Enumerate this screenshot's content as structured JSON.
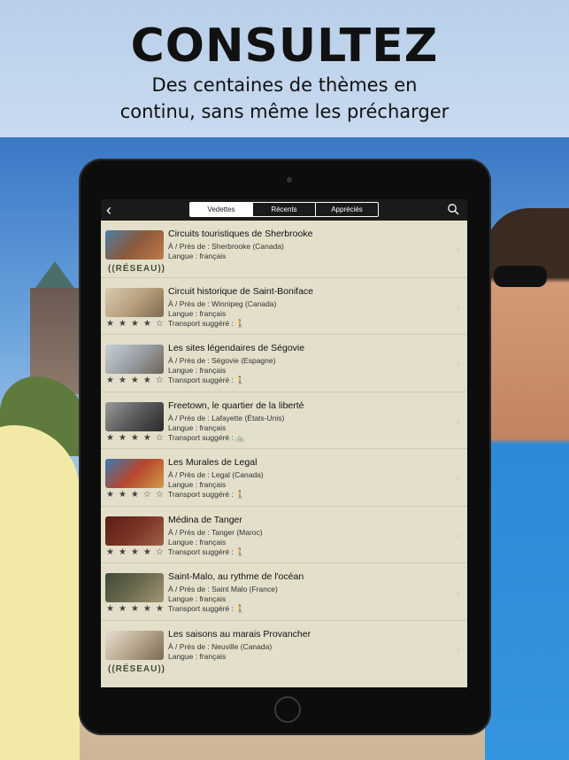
{
  "promo": {
    "headline": "CONSULTEZ",
    "subtitle_line1": "Des centaines de thèmes en",
    "subtitle_line2": "continu, sans même les précharger"
  },
  "navbar": {
    "back_icon": "chevron-left-icon",
    "back_glyph": "‹",
    "tabs": [
      {
        "label": "Vedettes",
        "active": true
      },
      {
        "label": "Récents",
        "active": false
      },
      {
        "label": "Appréciés",
        "active": false
      }
    ],
    "search_icon": "search-icon"
  },
  "tours": [
    {
      "title": "Circuits touristiques de Sherbrooke",
      "near": "À / Près de : Sherbrooke (Canada)",
      "language": "Langue : français",
      "transport": "",
      "rating_display": "",
      "badge": "((RÉSEAU))",
      "thumb_color": "#8a5a3c"
    },
    {
      "title": "Circuit historique de Saint-Boniface",
      "near": "À / Près de : Winnipeg (Canada)",
      "language": "Langue : français",
      "transport": "Transport suggéré : 🚶",
      "rating_display": "★★★★☆",
      "badge": "",
      "thumb_color": "#b7a17e"
    },
    {
      "title": "Les sites légendaires de Ségovie",
      "near": "À / Près de : Ségovie (Espagne)",
      "language": "Langue : français",
      "transport": "Transport suggéré : 🚶",
      "rating_display": "★★★★☆",
      "badge": "",
      "thumb_color": "#9aa0a5"
    },
    {
      "title": "Freetown, le quartier de la liberté",
      "near": "À / Près de : Lafayette (États-Unis)",
      "language": "Langue : français",
      "transport": "Transport suggéré : 🚲",
      "rating_display": "★★★★☆",
      "badge": "",
      "thumb_color": "#6d6d6d"
    },
    {
      "title": "Les Murales de Legal",
      "near": "À / Près de : Legal (Canada)",
      "language": "Langue : français",
      "transport": "Transport suggéré : 🚶",
      "rating_display": "★★★☆☆",
      "badge": "",
      "thumb_color": "#3d7bb0"
    },
    {
      "title": "Médina de Tanger",
      "near": "À / Près de : Tanger (Maroc)",
      "language": "Langue : français",
      "transport": "Transport suggéré : 🚶",
      "rating_display": "★★★★☆",
      "badge": "",
      "thumb_color": "#7b3324"
    },
    {
      "title": "Saint-Malo, au rythme de l'océan",
      "near": "À / Près de : Saint Malo (France)",
      "language": "Langue : français",
      "transport": "Transport suggéré : 🚶",
      "rating_display": "★★★★★",
      "badge": "",
      "thumb_color": "#6b6a4e"
    },
    {
      "title": "Les saisons au marais Provancher",
      "near": "À / Près de : Neuville (Canada)",
      "language": "Langue : français",
      "transport": "",
      "rating_display": "",
      "badge": "((RÉSEAU))",
      "thumb_color": "#b9a88f"
    }
  ]
}
